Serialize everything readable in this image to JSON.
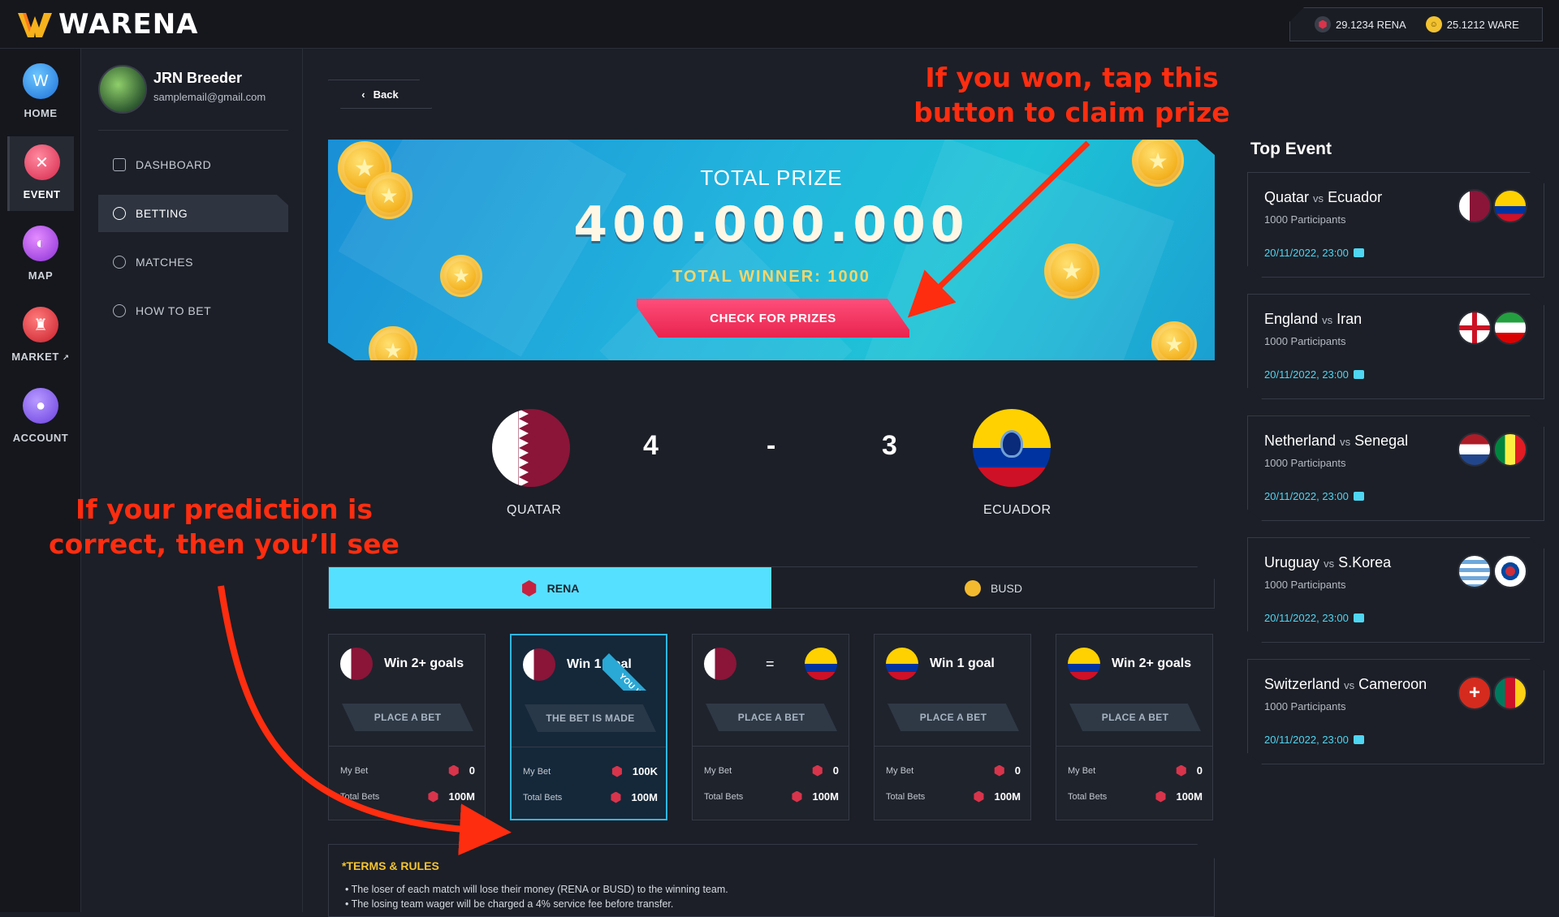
{
  "app": {
    "brand": "WARENA"
  },
  "wallet": {
    "rena": "29.1234 RENA",
    "ware": "25.1212 WARE"
  },
  "nav": [
    {
      "label": "HOME",
      "icon": "home-icon"
    },
    {
      "label": "EVENT",
      "icon": "event-icon"
    },
    {
      "label": "MAP",
      "icon": "map-icon"
    },
    {
      "label": "MARKET",
      "icon": "market-icon"
    },
    {
      "label": "ACCOUNT",
      "icon": "account-icon"
    }
  ],
  "user": {
    "name": "JRN Breeder",
    "email": "samplemail@gmail.com"
  },
  "menu": [
    {
      "label": "DASHBOARD",
      "icon": "dashboard-icon"
    },
    {
      "label": "BETTING",
      "icon": "betting-icon"
    },
    {
      "label": "MATCHES",
      "icon": "matches-icon"
    },
    {
      "label": "HOW TO BET",
      "icon": "help-icon"
    }
  ],
  "back_label": "Back",
  "prize": {
    "title": "TOTAL PRIZE",
    "amount": "400.000.000",
    "winners": "TOTAL WINNER: 1000",
    "button": "CHECK FOR PRIZES"
  },
  "match": {
    "home": {
      "name": "QUATAR",
      "score": "4"
    },
    "away": {
      "name": "ECUADOR",
      "score": "3"
    },
    "separator": "-"
  },
  "tabs": [
    {
      "label": "RENA"
    },
    {
      "label": "BUSD"
    }
  ],
  "cards": [
    {
      "title": "Win 2+ goals",
      "button": "PLACE A BET",
      "my_bet_label": "My Bet",
      "my_bet": "0",
      "total_label": "Total Bets",
      "total": "100M"
    },
    {
      "title": "Win 1 goal",
      "button": "THE BET IS MADE",
      "my_bet_label": "My Bet",
      "my_bet": "100K",
      "total_label": "Total Bets",
      "total": "100M",
      "ribbon": "YOU WON"
    },
    {
      "title": "=",
      "button": "PLACE A BET",
      "my_bet_label": "My Bet",
      "my_bet": "0",
      "total_label": "Total Bets",
      "total": "100M"
    },
    {
      "title": "Win 1 goal",
      "button": "PLACE A BET",
      "my_bet_label": "My Bet",
      "my_bet": "0",
      "total_label": "Total Bets",
      "total": "100M"
    },
    {
      "title": "Win 2+ goals",
      "button": "PLACE A BET",
      "my_bet_label": "My Bet",
      "my_bet": "0",
      "total_label": "Total Bets",
      "total": "100M"
    }
  ],
  "terms": {
    "title": "*TERMS & RULES",
    "items": [
      "The loser of each match will lose their money (RENA or BUSD) to the winning team.",
      "The losing team wager will be charged a 4% service fee before transfer."
    ]
  },
  "top_event": {
    "title": "Top Event",
    "events": [
      {
        "home": "Quatar",
        "vs": "vs",
        "away": "Ecuador",
        "participants": "1000 Participants",
        "date": "20/11/2022, 23:00"
      },
      {
        "home": "England",
        "vs": "vs",
        "away": "Iran",
        "participants": "1000 Participants",
        "date": "20/11/2022, 23:00"
      },
      {
        "home": "Netherland",
        "vs": "vs",
        "away": "Senegal",
        "participants": "1000 Participants",
        "date": "20/11/2022, 23:00"
      },
      {
        "home": "Uruguay",
        "vs": "vs",
        "away": "S.Korea",
        "participants": "1000 Participants",
        "date": "20/11/2022, 23:00"
      },
      {
        "home": "Switzerland",
        "vs": "vs",
        "away": "Cameroon",
        "participants": "1000 Participants",
        "date": "20/11/2022, 23:00"
      }
    ]
  },
  "annotations": {
    "top": "If you won, tap this button to claim prize",
    "left": "If your prediction is correct, then you’ll see"
  },
  "colors": {
    "accent": "#56e0ff",
    "cta": "#ff3d68",
    "annotation": "#ff2d10",
    "won_border": "#2fb6e0"
  }
}
